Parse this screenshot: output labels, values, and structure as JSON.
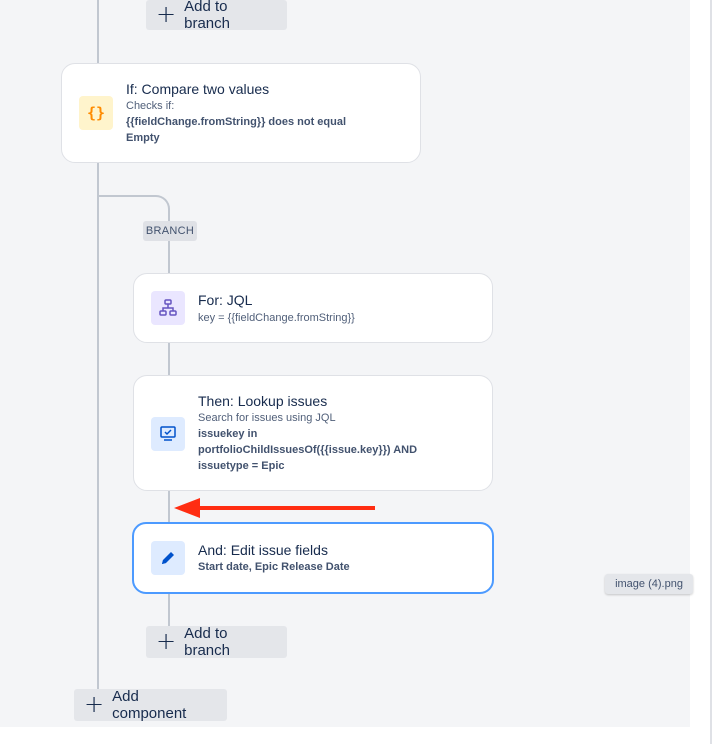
{
  "flow": {
    "add_to_branch_top": "Add to branch",
    "condition": {
      "title": "If: Compare two values",
      "checks_label": "Checks if:",
      "expression_line1": "{{fieldChange.fromString}} does not equal",
      "expression_line2": "Empty",
      "icon": "curly-braces-icon"
    },
    "branch_tag": "BRANCH",
    "for_jql": {
      "title": "For: JQL",
      "detail": "key = {{fieldChange.fromString}}",
      "icon": "branch-hierarchy-icon"
    },
    "lookup": {
      "title": "Then: Lookup issues",
      "subtitle": "Search for issues using JQL",
      "query_line1": "issuekey in",
      "query_line2": "portfolioChildIssuesOf({{issue.key}}) AND",
      "query_line3": "issuetype = Epic",
      "icon": "monitor-search-icon"
    },
    "edit": {
      "title": "And: Edit issue fields",
      "fields": "Start date, Epic Release Date",
      "icon": "pencil-icon"
    },
    "add_to_branch_bottom": "Add to branch",
    "add_component": "Add component"
  },
  "tooltip": "image (4).png",
  "colors": {
    "accent_border": "#4c9aff",
    "arrow": "#ff2d12",
    "condition_icon_bg": "#fff4cc",
    "condition_icon_fg": "#ff8b00",
    "branch_icon_bg": "#eae6ff",
    "branch_icon_fg": "#6554c0",
    "action_icon_bg": "#deebff",
    "action_icon_fg": "#0052cc"
  }
}
